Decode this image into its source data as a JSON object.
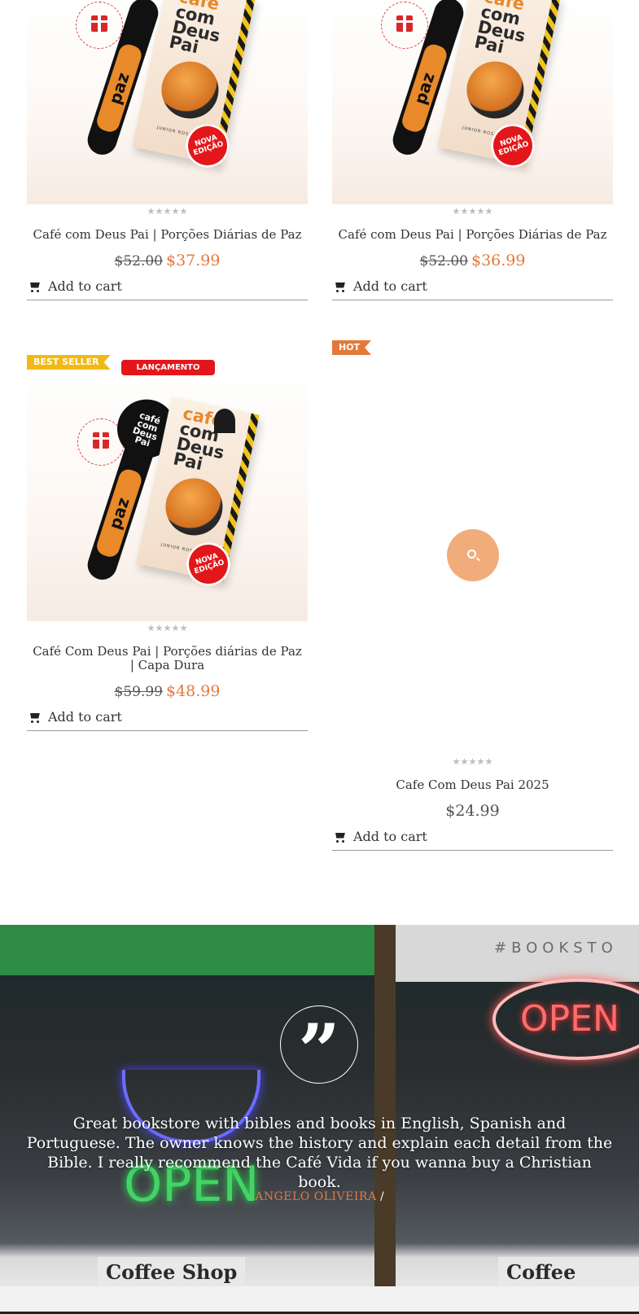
{
  "products": [
    {
      "title": "Café com Deus Pai | Porções Diárias de Paz",
      "old_price": "$52.00",
      "price": "$37.99",
      "add_to_cart": "Add to cart"
    },
    {
      "title": "Café com Deus Pai | Porções Diárias de Paz",
      "old_price": "$52.00",
      "price": "$36.99",
      "add_to_cart": "Add to cart"
    },
    {
      "badge": "BEST SELLER",
      "label": "LANÇAMENTO",
      "title": "Café Com Deus Pai | Porções diárias de Paz | Capa Dura",
      "old_price": "$59.99",
      "price": "$48.99",
      "add_to_cart": "Add to cart"
    },
    {
      "badge": "HOT",
      "title": "Cafe Com Deus Pai 2025",
      "price": "$24.99",
      "add_to_cart": "Add to cart"
    }
  ],
  "book_cover": {
    "title_1": "café",
    "title_2": "com",
    "title_3": "Deus",
    "title_4": "Pai",
    "spoon_text": "café com Deus Pai",
    "paz": "paz",
    "nova": "NOVA EDIÇÃO",
    "author": "JUNIOR ROSTIROLA"
  },
  "testimonial": {
    "quote_mark": "”",
    "text": "Great bookstore with bibles and books in English, Spanish and Portuguese. The owner knows the history and explain each detail from the Bible. I really recommend the Café Vida if you wanna buy a Christian book.",
    "author": "ANGELO OLIVEIRA",
    "separator": "/",
    "bg_sign": "#BOOKSTO",
    "bg_open_right": "OPEN",
    "bg_open_left": "OPEN",
    "bg_coffee_shop": "Coffee Shop"
  },
  "colors": {
    "accent": "#e4793a",
    "best_seller": "#f2b915",
    "launch": "#e3171b"
  }
}
